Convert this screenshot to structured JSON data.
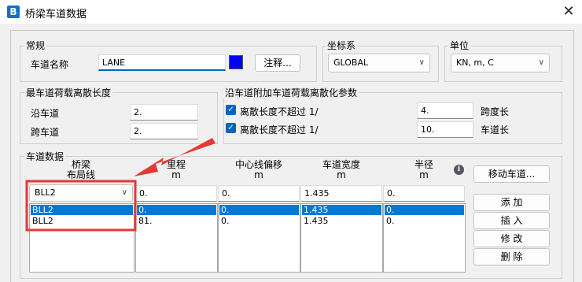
{
  "window": {
    "title": "桥梁车道数据",
    "icon_letter": "B",
    "close_glyph": "✕"
  },
  "general": {
    "group_label": "常规",
    "lane_name_label": "车道名称",
    "lane_name_value": "LANE",
    "lane_color": "#0000ff",
    "notes_button": "注释..."
  },
  "coord_system": {
    "group_label": "坐标系",
    "selected": "GLOBAL"
  },
  "units": {
    "group_label": "单位",
    "selected": "KN, m, C"
  },
  "max_discretization": {
    "group_label": "最车道荷载离散长度",
    "along_label": "沿车道",
    "along_value": "2.",
    "across_label": "跨车道",
    "across_value": "2."
  },
  "additional_discretization": {
    "group_label": "沿车道附加车道荷载离散化参数",
    "rows": [
      {
        "checked": true,
        "label": "离散长度不超过 1/",
        "value": "4.",
        "suffix": "跨度长"
      },
      {
        "checked": true,
        "label": "离散长度不超过 1/",
        "value": "10.",
        "suffix": "车道长"
      }
    ]
  },
  "lane_data": {
    "group_label": "车道数据",
    "columns": [
      {
        "line1": "桥梁",
        "line2": "布局线"
      },
      {
        "line1": "里程",
        "line2": "m"
      },
      {
        "line1": "中心线偏移",
        "line2": "m"
      },
      {
        "line1": "车道宽度",
        "line2": "m"
      },
      {
        "line1": "半径",
        "line2": "m"
      }
    ],
    "entry": {
      "layout_line": "BLL2",
      "station": "0.",
      "offset": "0.",
      "width": "1.435",
      "radius": "0."
    },
    "rows": [
      {
        "layout_line": "BLL2",
        "station": "0.",
        "offset": "0.",
        "width": "1.435",
        "radius": "0.",
        "selected": true
      },
      {
        "layout_line": "BLL2",
        "station": "81.",
        "offset": "0.",
        "width": "1.435",
        "radius": "0.",
        "selected": false
      }
    ],
    "buttons": {
      "move_lane": "移动车道...",
      "add": "添 加",
      "insert": "插 入",
      "modify": "修 改",
      "delete": "删 除"
    },
    "info_glyph": "i"
  },
  "colors": {
    "annotation_red": "#e53935",
    "selection_blue": "#0078d7",
    "accent": "#0067c0"
  }
}
